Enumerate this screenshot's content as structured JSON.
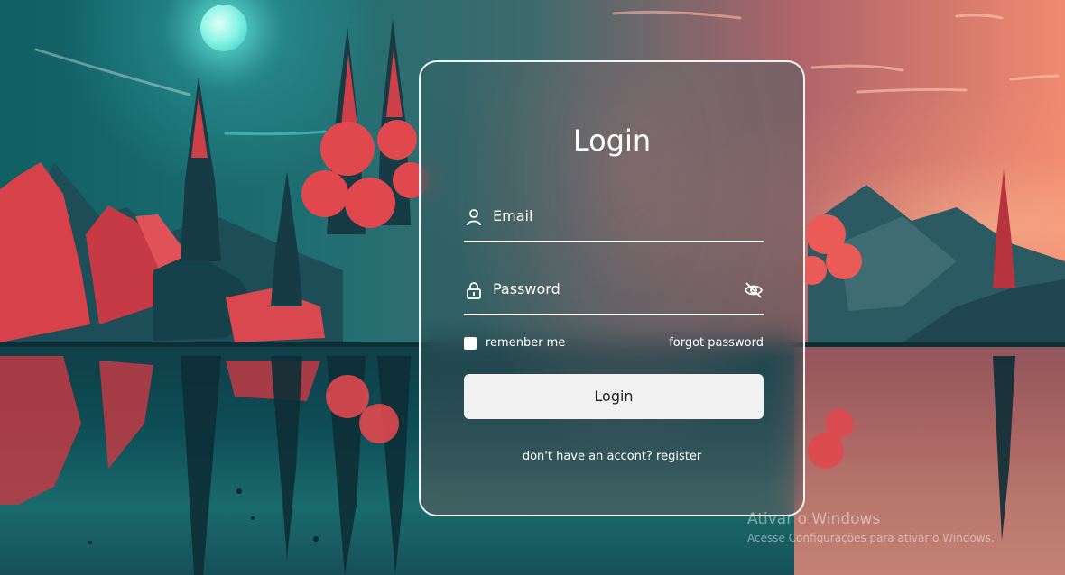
{
  "login_card": {
    "title": "Login",
    "email_label": "Email",
    "password_label": "Password",
    "remember_label": "remenber me",
    "forgot_label": "forgot password",
    "submit_label": "Login",
    "register_label": "don't have an accont? register"
  },
  "icons": {
    "email": "user-icon",
    "password": "lock-icon",
    "toggle_password": "eye-off-icon"
  },
  "windows_watermark": {
    "line1": "Ativar o Windows",
    "line2": "Acesse Configurações para ativar o Windows."
  },
  "colors": {
    "card_border": "#ffffff",
    "button_bg": "#f1f1f1",
    "text": "#ffffff"
  }
}
